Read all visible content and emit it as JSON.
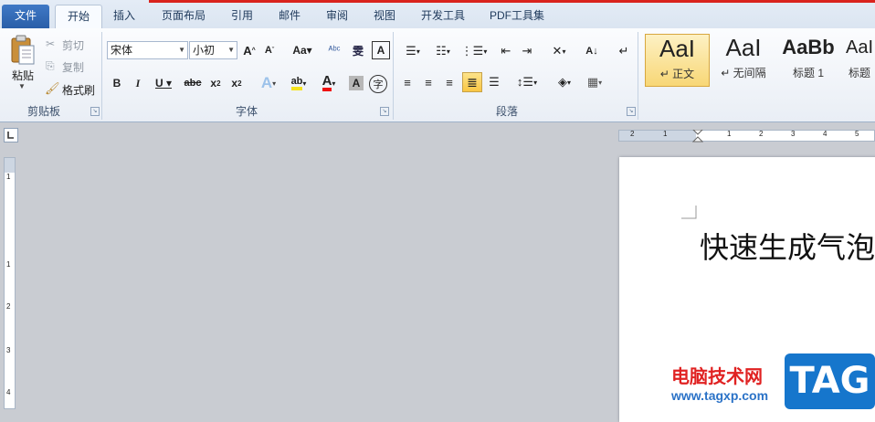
{
  "tabs": {
    "file": "文件",
    "home": "开始",
    "insert": "插入",
    "page_layout": "页面布局",
    "references": "引用",
    "mailings": "邮件",
    "review": "审阅",
    "view": "视图",
    "developer": "开发工具",
    "pdf": "PDF工具集"
  },
  "clipboard": {
    "paste": "粘贴",
    "cut": "剪切",
    "copy": "复制",
    "format_painter": "格式刷",
    "group_label": "剪贴板"
  },
  "font": {
    "name_value": "宋体",
    "size_value": "小初",
    "group_label": "字体"
  },
  "paragraph": {
    "group_label": "段落"
  },
  "styles": {
    "items": [
      {
        "sample": "AaI",
        "name": "↵ 正文"
      },
      {
        "sample": "AaI",
        "name": "↵ 无间隔"
      },
      {
        "sample": "AaBb",
        "name": "标题 1"
      },
      {
        "sample": "AaI",
        "name": "标题"
      }
    ]
  },
  "ruler": {
    "h_labels": [
      "2",
      "1",
      "1",
      "2",
      "3",
      "4",
      "5"
    ],
    "v_labels": [
      "1",
      "1",
      "2",
      "3",
      "4"
    ]
  },
  "document": {
    "text": "快速生成气泡"
  },
  "watermark": {
    "site_cn": "电脑技术网",
    "site_url": "www.tagxp.com",
    "badge": "TAG"
  }
}
